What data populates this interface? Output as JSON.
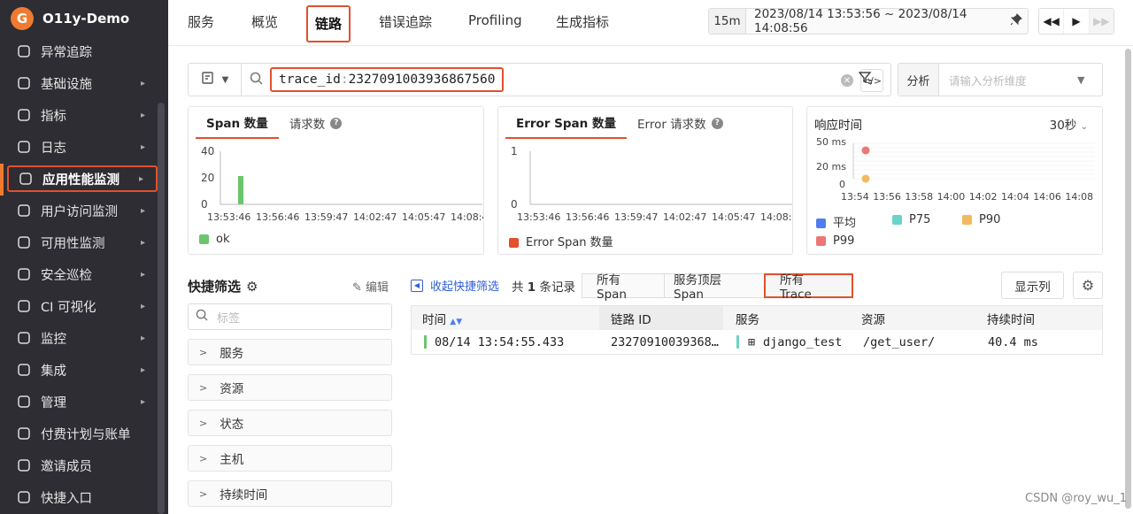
{
  "sidebar": {
    "logo_letter": "G",
    "org_name": "O11y-Demo",
    "items": [
      {
        "label": "异常追踪",
        "icon": "anomaly-icon",
        "arrow": ""
      },
      {
        "label": "基础设施",
        "icon": "infrastructure-icon",
        "arrow": "▸"
      },
      {
        "label": "指标",
        "icon": "metrics-icon",
        "arrow": "▸"
      },
      {
        "label": "日志",
        "icon": "log-icon",
        "arrow": "▸"
      },
      {
        "label": "应用性能监测",
        "icon": "apm-icon",
        "arrow": "▸"
      },
      {
        "label": "用户访问监测",
        "icon": "rum-icon",
        "arrow": "▸"
      },
      {
        "label": "可用性监测",
        "icon": "availability-icon",
        "arrow": "▸"
      },
      {
        "label": "安全巡检",
        "icon": "security-icon",
        "arrow": "▸"
      },
      {
        "label": "CI 可视化",
        "icon": "ci-icon",
        "arrow": "▸"
      },
      {
        "label": "监控",
        "icon": "monitor-icon",
        "arrow": "▸"
      },
      {
        "label": "集成",
        "icon": "integration-icon",
        "arrow": "▸"
      },
      {
        "label": "管理",
        "icon": "management-icon",
        "arrow": "▸"
      },
      {
        "label": "付费计划与账单",
        "icon": "billing-icon",
        "arrow": ""
      },
      {
        "label": "邀请成员",
        "icon": "invite-icon",
        "arrow": ""
      },
      {
        "label": "快捷入口",
        "icon": "shortcut-icon",
        "arrow": ""
      }
    ]
  },
  "tabs": [
    "服务",
    "概览",
    "链路",
    "错误追踪",
    "Profiling",
    "生成指标"
  ],
  "time": {
    "quick": "15m",
    "range": "2023/08/14 13:53:56 ~ 2023/08/14 14:08:56"
  },
  "search": {
    "key": "trace_id",
    "sep": ":",
    "value": "2327091003936867560"
  },
  "analysis": {
    "label": "分析",
    "placeholder": "请输入分析维度"
  },
  "cards": {
    "span": {
      "tab1": "Span 数量",
      "tab2": "请求数",
      "legend": "ok"
    },
    "error": {
      "tab1": "Error Span 数量",
      "tab2": "Error 请求数",
      "legend": "Error Span 数量"
    },
    "resp": {
      "title": "响应时间",
      "interval": "30秒"
    }
  },
  "chart_data": [
    {
      "type": "bar",
      "title": "Span 数量",
      "x_ticks": [
        "13:53:46",
        "13:56:46",
        "13:59:47",
        "14:02:47",
        "14:05:47",
        "14:08:4"
      ],
      "y_ticks": [
        "40",
        "20",
        "0"
      ],
      "ylim": [
        0,
        45
      ],
      "series": [
        {
          "name": "ok",
          "color": "#6cc56c",
          "points": [
            {
              "x": "13:54:46",
              "y": 24
            }
          ]
        }
      ]
    },
    {
      "type": "bar",
      "title": "Error Span 数量",
      "x_ticks": [
        "13:53:46",
        "13:56:46",
        "13:59:47",
        "14:02:47",
        "14:05:47",
        "14:08:4"
      ],
      "y_ticks": [
        "1",
        "0"
      ],
      "ylim": [
        0,
        1
      ],
      "series": [
        {
          "name": "Error Span 数量",
          "color": "#e2502c",
          "points": []
        }
      ]
    },
    {
      "type": "scatter",
      "title": "响应时间",
      "x_ticks": [
        "13:54",
        "13:56",
        "13:58",
        "14:00",
        "14:02",
        "14:04",
        "14:06",
        "14:08"
      ],
      "y_ticks": [
        "50 ms",
        "20 ms",
        "0"
      ],
      "series": [
        {
          "name": "平均",
          "color": "#4f7df0",
          "points": []
        },
        {
          "name": "P75",
          "color": "#6cd3c8",
          "points": []
        },
        {
          "name": "P90",
          "color": "#f3b95f",
          "points": [
            {
              "x": "13:54",
              "y": 0
            }
          ]
        },
        {
          "name": "P99",
          "color": "#ec7676",
          "points": [
            {
              "x": "13:54",
              "y": 40
            }
          ]
        }
      ]
    }
  ],
  "quick_filter": {
    "title": "快捷筛选",
    "edit": "编辑",
    "placeholder": "标签",
    "facets": [
      "服务",
      "资源",
      "状态",
      "主机",
      "持续时间"
    ]
  },
  "list": {
    "collapse": "收起快捷筛选",
    "count_prefix": "共",
    "count": "1",
    "count_suffix": "条记录",
    "segments": [
      "所有 Span",
      "服务顶层 Span",
      "所有 Trace"
    ],
    "columns_btn": "显示列",
    "headers": [
      "时间",
      "链路 ID",
      "服务",
      "资源",
      "持续时间"
    ],
    "rows": [
      {
        "time": "08/14 13:54:55.433",
        "trace_id": "23270910039368…",
        "service": "django_test",
        "resource": "/get_user/",
        "duration": "40.4 ms"
      }
    ]
  },
  "watermark": "CSDN @roy_wu_1"
}
